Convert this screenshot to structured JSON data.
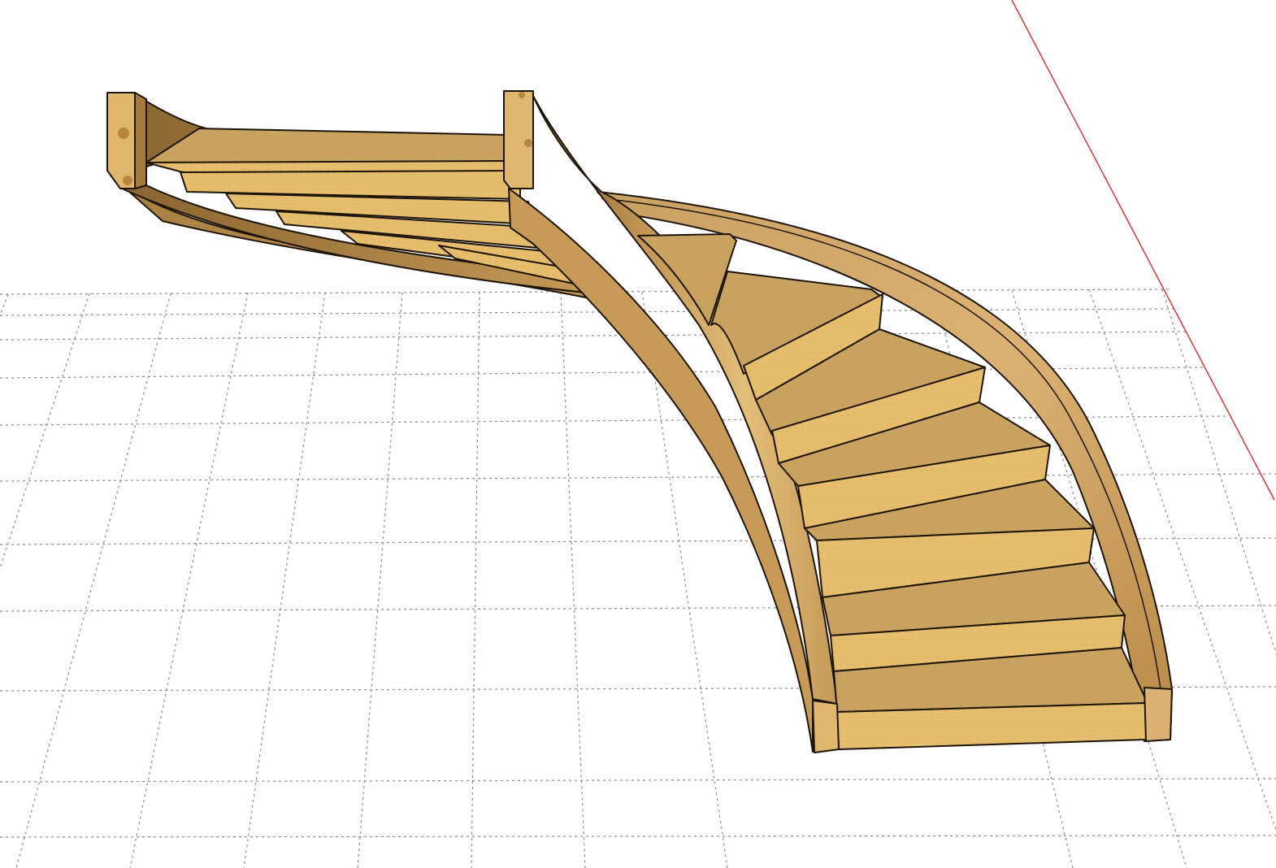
{
  "scene": {
    "subject": "curved-wooden-staircase",
    "background_color": "#ffffff",
    "grid": {
      "visible": true,
      "line_color": "#8a8a8a",
      "dash_style": "dotted"
    },
    "red_axis": {
      "visible": true,
      "color": "#d42a2a"
    },
    "staircase": {
      "step_count": 14,
      "wood_colors": {
        "tread_top": "#c8a25e",
        "riser_face": "#e6bd6c",
        "stringer_light": "#d9b070",
        "stringer_mid": "#c09352",
        "stringer_dark": "#7a5a2a",
        "post_face": "#e0b76e",
        "knot": "#b8863c",
        "outline": "#1d1408"
      }
    }
  }
}
